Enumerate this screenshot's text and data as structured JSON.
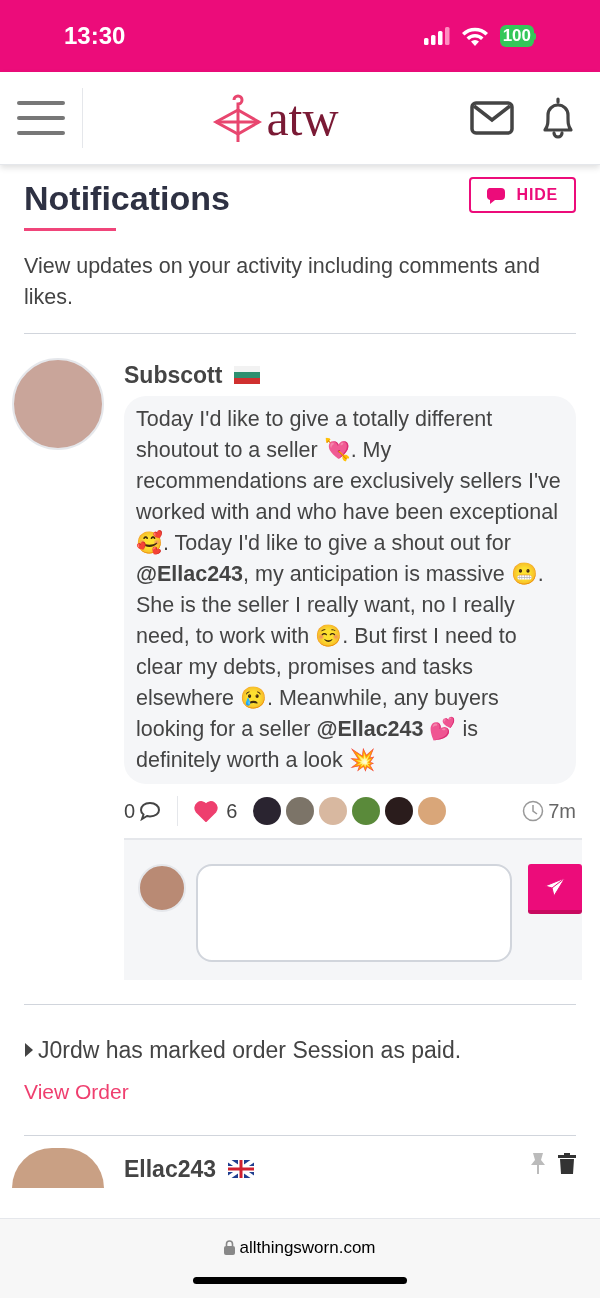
{
  "status_bar": {
    "time": "13:30",
    "battery": "100"
  },
  "header": {
    "logo_text": "atw"
  },
  "page": {
    "title": "Notifications",
    "hide_button": "HIDE",
    "description": "View updates on your activity including comments and likes."
  },
  "notifications": [
    {
      "kind": "post",
      "author": "Subscott",
      "flag": {
        "kind": "bulgaria"
      },
      "message": "Today I'd like to give a totally different shoutout to a seller 💘. My recommendations are exclusively sellers I've worked with and who have been exceptional 🥰. Today I'd like to give a shout out for **@Ellac243**, my anticipation is massive 😬. She is the seller I really want, no I really need, to work with ☺️. But first I need to clear my debts, promises and tasks elsewhere 😢. Meanwhile, any buyers looking for a seller **@Ellac243** 💕 is definitely worth a look 💥",
      "comments": "0",
      "likes": "6",
      "liked": true,
      "time": "7m"
    },
    {
      "kind": "order",
      "text": "J0rdw has marked order Session as paid.",
      "link": "View Order"
    },
    {
      "kind": "post_preview",
      "author": "Ellac243",
      "flag": {
        "kind": "uk"
      }
    }
  ],
  "browser_bar": {
    "url": "allthingsworn.com"
  }
}
